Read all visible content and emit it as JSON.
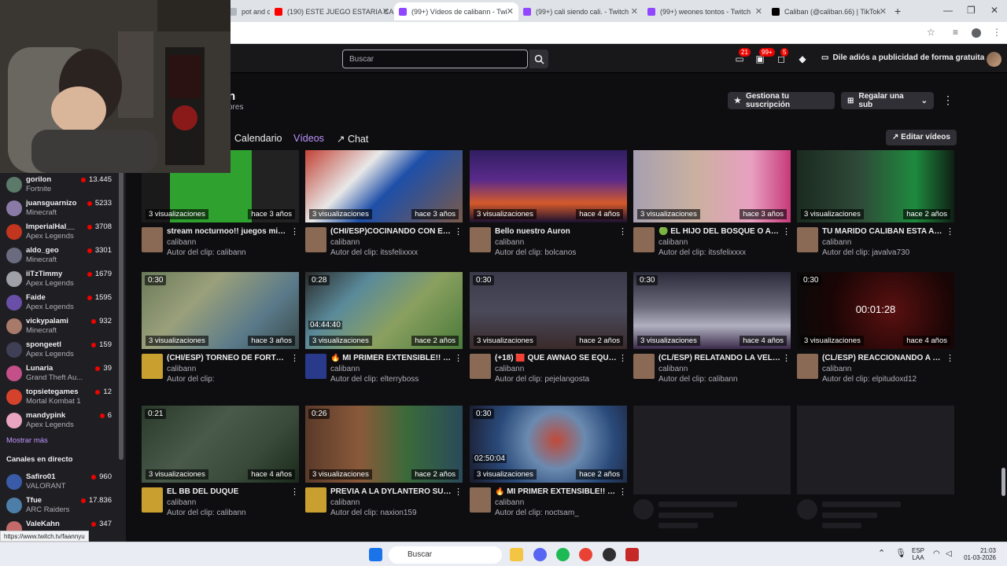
{
  "browser": {
    "tabs": [
      {
        "title": "pot and c",
        "color": "#b0b6bd",
        "active": false
      },
      {
        "title": "(190) ESTE JUEGO ESTARIA CA",
        "color": "#ff0000",
        "active": false
      },
      {
        "title": "(99+) Vídeos de calibann - Twi",
        "color": "#9146ff",
        "active": true
      },
      {
        "title": "(99+) cali siendo cali. - Twitch",
        "color": "#9146ff",
        "active": false
      },
      {
        "title": "(99+) weones tontos - Twitch",
        "color": "#9146ff",
        "active": false
      },
      {
        "title": "Caliban (@caliban.66) | TikTok",
        "color": "#000000",
        "active": false
      }
    ],
    "new_tab": "+",
    "status_url": "https://www.twitch.tv/faannyu"
  },
  "topnav": {
    "search_placeholder": "Buscar",
    "badges": {
      "inbox": "21",
      "whispers_count": "99+",
      "notifications": "5"
    },
    "ad_free_label": "Dile adiós a publicidad de forma gratuita"
  },
  "sidebar": {
    "followed": [
      {
        "name": "gorilon",
        "game": "Fortnite",
        "viewers": "13.445",
        "color": "#5c7a6a"
      },
      {
        "name": "juansguarnizo",
        "game": "Minecraft",
        "viewers": "5233",
        "color": "#8a7aa8"
      },
      {
        "name": "ImperialHal__",
        "game": "Apex Legends",
        "viewers": "3708",
        "color": "#c2351f"
      },
      {
        "name": "aldo_geo",
        "game": "Minecraft",
        "viewers": "3301",
        "color": "#6b6b80"
      },
      {
        "name": "iiTzTimmy",
        "game": "Apex Legends",
        "viewers": "1679",
        "color": "#9fa0a8"
      },
      {
        "name": "Faide",
        "game": "Apex Legends",
        "viewers": "1595",
        "color": "#6a4fa8"
      },
      {
        "name": "vickypalami",
        "game": "Minecraft",
        "viewers": "932",
        "color": "#a87a6a"
      },
      {
        "name": "spongeetl",
        "game": "Apex Legends",
        "viewers": "159",
        "color": "#3f3f55"
      },
      {
        "name": "Lunaria",
        "game": "Grand Theft Au...",
        "viewers": "39",
        "color": "#c4508a"
      },
      {
        "name": "topsietegames",
        "game": "Mortal Kombat 1",
        "viewers": "12",
        "color": "#d4422c"
      },
      {
        "name": "mandypink",
        "game": "Apex Legends",
        "viewers": "6",
        "color": "#e8a4c0"
      }
    ],
    "show_more": "Mostrar más",
    "live_section": "Canales en directo",
    "live": [
      {
        "name": "Safiro01",
        "game": "VALORANT",
        "viewers": "960",
        "color": "#3a5ba8"
      },
      {
        "name": "Tfue",
        "game": "ARC Raiders",
        "viewers": "17.836",
        "color": "#4d7ea8"
      },
      {
        "name": "ValeKahn",
        "game": "",
        "viewers": "347",
        "color": "#c46a6a"
      }
    ]
  },
  "channel": {
    "name": "n",
    "sub_text": "ores",
    "manage_sub": "Gestiona tu suscripción",
    "gift_sub": "Regalar una sub",
    "tabs": [
      "Calendario",
      "Vídeos",
      "Chat"
    ],
    "active_tab": "Vídeos",
    "edit_videos": "Editar vídeos"
  },
  "clips": [
    {
      "duration": "",
      "views": "3 visualizaciones",
      "age": "hace 3 años",
      "title": "stream nocturnoo!! juegos mier...",
      "channel": "calibann",
      "author": "Autor del clip: calibann",
      "bg": "linear-gradient(90deg,#1a1a1a 0%,#1a1a1a 18%,#2fa12f 18%,#2fa12f 70%,#222 70%)",
      "avatar": "#8a6a55",
      "stamp": ""
    },
    {
      "duration": "",
      "views": "3 visualizaciones",
      "age": "hace 3 años",
      "title": "(CHI/ESP)COCINANDO CON EL ...",
      "channel": "calibann",
      "author": "Autor del clip: itssfelixxxx",
      "bg": "linear-gradient(135deg,#c0392b 0%,#e8e8e8 35%,#1e4fa8 55%,#7a5a4a 100%)",
      "avatar": "#8a6a55",
      "stamp": ""
    },
    {
      "duration": "",
      "views": "3 visualizaciones",
      "age": "hace 4 años",
      "title": "Bello nuestro Auron",
      "channel": "calibann",
      "author": "Autor del clip: bolcanos",
      "bg": "linear-gradient(180deg,#2a1c5a 0%,#5a2a8a 45%,#d45a2a 75%,#1a1030 100%)",
      "avatar": "#8a6a55",
      "stamp": ""
    },
    {
      "duration": "",
      "views": "3 visualizaciones",
      "age": "hace 3 años",
      "title": "🟢 EL HIJO DEL BOSQUE O ALG...",
      "channel": "calibann",
      "author": "Autor del clip: itssfelixxxx",
      "bg": "linear-gradient(90deg,#a7a0b0 0%,#cbb0a0 40%,#e8a0c0 75%,#c73a7a 100%)",
      "avatar": "#8a6a55",
      "stamp": ""
    },
    {
      "duration": "",
      "views": "3 visualizaciones",
      "age": "hace 2 años",
      "title": "TU MARIDO CALIBAN ESTA AQU...",
      "channel": "calibann",
      "author": "Autor del clip: javalva730",
      "bg": "linear-gradient(90deg,#1a2a20 0%,#2f4a38 40%,#1e8a3e 75%,#0f1f14 100%)",
      "avatar": "#8a6a55",
      "stamp": ""
    },
    {
      "duration": "0:30",
      "views": "3 visualizaciones",
      "age": "hace 3 años",
      "title": "(CHI/ESP) TORNEO DE FORTNIT...",
      "channel": "calibann",
      "author": "Autor del clip:",
      "bg": "linear-gradient(135deg,#6a7a5a 0%,#9aa07a 35%,#5a7a8a 70%,#3a4a4a 100%)",
      "avatar": "#c9a030",
      "stamp": ""
    },
    {
      "duration": "0:28",
      "views": "3 visualizaciones",
      "age": "hace 2 años",
      "title": "🔥 MI PRIMER EXTENSIBLE!! 🔥 ...",
      "channel": "calibann",
      "author": "Autor del clip: elterryboss",
      "bg": "linear-gradient(135deg,#2a2a2a 0%,#5a8a9a 30%,#8aa060 60%,#4a7a3a 100%)",
      "avatar": "#2a3a8a",
      "stamp": "04:44:40"
    },
    {
      "duration": "0:30",
      "views": "3 visualizaciones",
      "age": "hace 2 años",
      "title": "(+18) 🟥 QUE AWNAO SE EQUIV...",
      "channel": "calibann",
      "author": "Autor del clip: pejelangosta",
      "bg": "linear-gradient(180deg,#3a3a4a 0%,#4a4a5a 50%,#3a2a2a 100%)",
      "avatar": "#8a6a55",
      "stamp": ""
    },
    {
      "duration": "0:30",
      "views": "3 visualizaciones",
      "age": "hace 4 años",
      "title": "(CL/ESP) RELATANDO LA VELA...",
      "channel": "calibann",
      "author": "Autor del clip: calibann",
      "bg": "linear-gradient(180deg,#2a2a3a 0%,#6a6a7a 45%,#b0b0c0 70%,#3a2a4a 100%)",
      "avatar": "#8a6a55",
      "stamp": ""
    },
    {
      "duration": "0:30",
      "views": "3 visualizaciones",
      "age": "hace 4 años",
      "title": "(CL/ESP) REACCIONANDO A LA ...",
      "channel": "calibann",
      "author": "Autor del clip: elpitudoxd12",
      "bg": "radial-gradient(circle at 60% 50%,#5a1010 0%,#1a0505 60%,#0a0a0a 100%)",
      "avatar": "#8a6a55",
      "stamp": "",
      "center": "00:01:28"
    },
    {
      "duration": "0:21",
      "views": "3 visualizaciones",
      "age": "hace 4 años",
      "title": "EL BB DEL DUQUE",
      "channel": "calibann",
      "author": "Autor del clip: calibann",
      "bg": "linear-gradient(135deg,#2a3a2a 0%,#4a5a4a 40%,#3a4a3a 70%,#1a2a1a 100%)",
      "avatar": "#c9a030",
      "stamp": ""
    },
    {
      "duration": "0:26",
      "views": "3 visualizaciones",
      "age": "hace 2 años",
      "title": "PREVIA A LA DYLANTERO SUPE...",
      "channel": "calibann",
      "author": "Autor del clip: naxion159",
      "bg": "linear-gradient(90deg,#5a3a2a 0%,#8a5a3a 35%,#3a6a3a 65%,#2a4a5a 100%)",
      "avatar": "#c9a030",
      "stamp": ""
    },
    {
      "duration": "0:30",
      "views": "3 visualizaciones",
      "age": "hace 2 años",
      "title": "🔥 MI PRIMER EXTENSIBLE!! 🔥 ...",
      "channel": "calibann",
      "author": "Autor del clip: noctsam_",
      "bg": "radial-gradient(circle at 55% 45%,#c04a3a 0%,#6a8ab0 30%,#2a4a7a 60%,#1a1a2a 100%)",
      "avatar": "#8a6a55",
      "stamp": "02:50:04"
    }
  ],
  "taskbar": {
    "search": "Buscar",
    "lang_top": "ESP",
    "lang_bottom": "LAA",
    "time": "21:03",
    "date": "01-03-2026"
  }
}
